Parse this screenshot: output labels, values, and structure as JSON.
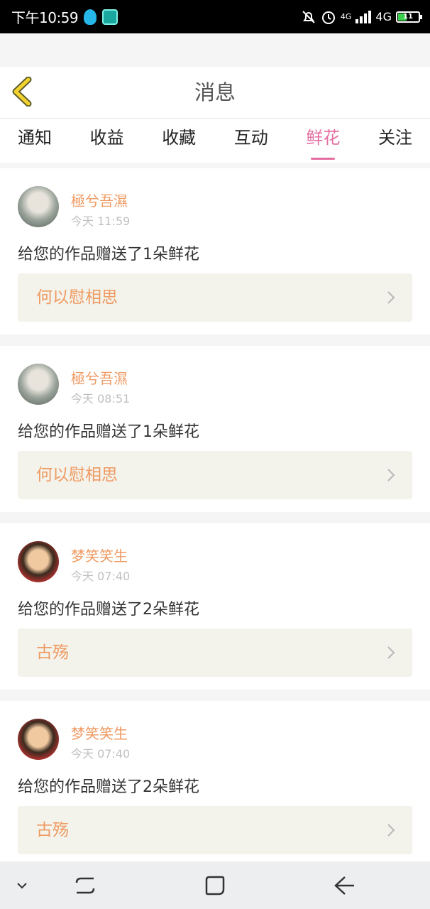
{
  "status_bar": {
    "time": "下午10:59",
    "network": "4G",
    "network_small": "4G",
    "battery": "11"
  },
  "header": {
    "title": "消息",
    "back_icon": "back-chevron-icon",
    "accent_color": "#f2d22e"
  },
  "tabs": [
    {
      "label": "通知",
      "active": false
    },
    {
      "label": "收益",
      "active": false
    },
    {
      "label": "收藏",
      "active": false
    },
    {
      "label": "互动",
      "active": false
    },
    {
      "label": "鲜花",
      "active": true
    },
    {
      "label": "关注",
      "active": false
    }
  ],
  "colors": {
    "active_tab": "#e36fa1",
    "name_orange": "#ef9a62",
    "work_bg": "#f3f3eb"
  },
  "messages": [
    {
      "user": "極兮吾濕",
      "time": "今天 11:59",
      "text": "给您的作品赠送了1朵鲜花",
      "work": "何以慰相思"
    },
    {
      "user": "極兮吾濕",
      "time": "今天 08:51",
      "text": "给您的作品赠送了1朵鲜花",
      "work": "何以慰相思"
    },
    {
      "user": "梦笑笑生",
      "time": "今天 07:40",
      "text": "给您的作品赠送了2朵鲜花",
      "work": "古殇"
    },
    {
      "user": "梦笑笑生",
      "time": "今天 07:40",
      "text": "给您的作品赠送了2朵鲜花",
      "work": "古殇"
    }
  ]
}
